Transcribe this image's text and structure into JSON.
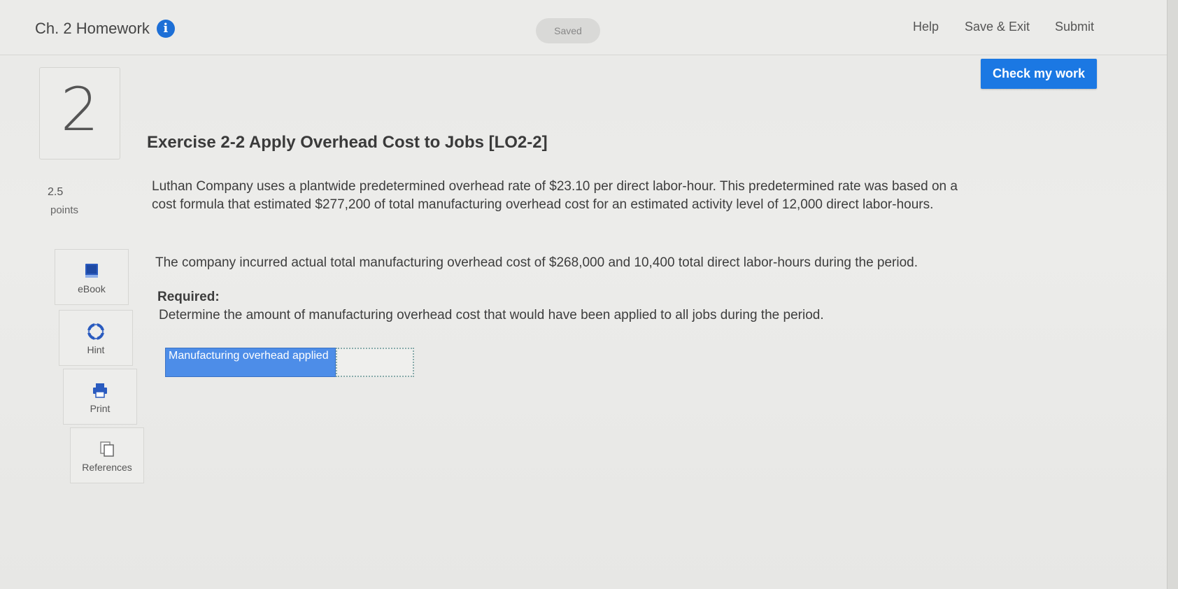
{
  "header": {
    "assignment_title": "Ch. 2 Homework",
    "info_icon": "info-icon",
    "saved_status": "Saved",
    "links": {
      "help": "Help",
      "save_exit": "Save & Exit",
      "submit": "Submit"
    }
  },
  "check_button": "Check my work",
  "question": {
    "number": "2",
    "title": "Exercise 2-2 Apply Overhead Cost to Jobs [LO2-2]",
    "points_value": "2.5",
    "points_label": "points",
    "paragraph1": "Luthan Company uses a plantwide predetermined overhead rate of $23.10 per direct labor-hour. This predetermined rate was based on a cost formula that estimated $277,200 of total manufacturing overhead cost for an estimated activity level of 12,000 direct labor-hours.",
    "paragraph2": "The company incurred actual total manufacturing overhead cost of $268,000 and 10,400 total direct labor-hours during the period.",
    "required_label": "Required:",
    "required_text": "Determine the amount of manufacturing overhead cost that would have been applied to all jobs during the period."
  },
  "tools": [
    {
      "label": "eBook",
      "icon": "book-icon"
    },
    {
      "label": "Hint",
      "icon": "lifebuoy-icon"
    },
    {
      "label": "Print",
      "icon": "printer-icon"
    },
    {
      "label": "References",
      "icon": "documents-icon"
    }
  ],
  "answer": {
    "label": "Manufacturing overhead applied",
    "value": ""
  },
  "colors": {
    "accent": "#1b78e3",
    "info_icon": "#1d6fd6",
    "answer_label_bg": "#4d8de8"
  }
}
